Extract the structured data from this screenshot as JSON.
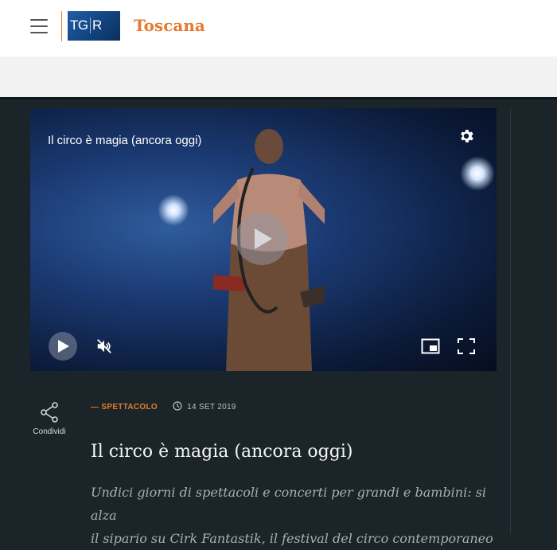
{
  "header": {
    "logo_text_left": "TG",
    "logo_text_right": "R",
    "region": "Toscana"
  },
  "video": {
    "title": "Il circo è magia (ancora oggi)"
  },
  "share": {
    "label": "Condividi"
  },
  "article": {
    "category": "— SPETTACOLO",
    "date": "14 SET 2019",
    "title": "Il circo è magia (ancora oggi)",
    "summary_line1": "Undici giorni di spettacoli e concerti per grandi e bambini: si alza",
    "summary_line2": "il sipario su Cirk Fantastik, il festival del circo contemporaneo"
  },
  "colors": {
    "accent": "#e67a2e",
    "page_bg": "#1b2529",
    "logo_blue": "#1e5ea8"
  },
  "icons": [
    "menu-icon",
    "gear-icon",
    "play-icon",
    "mute-icon",
    "pip-icon",
    "fullscreen-icon",
    "share-icon",
    "clock-icon"
  ]
}
